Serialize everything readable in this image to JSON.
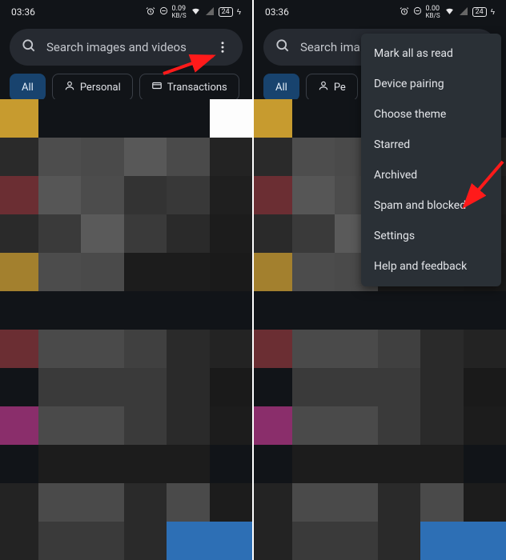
{
  "status": {
    "time": "03:36",
    "kbs_value": "0.09",
    "kbs_unit": "KB/S",
    "kbs_value2": "0.00",
    "battery": "24"
  },
  "search": {
    "placeholder_full": "Search images and videos",
    "placeholder_short": "Search ima"
  },
  "chips": {
    "all": "All",
    "personal": "Personal",
    "personal_short": "Pe",
    "transactions": "Transactions"
  },
  "menu": {
    "mark_all": "Mark all as read",
    "device_pairing": "Device pairing",
    "choose_theme": "Choose theme",
    "starred": "Starred",
    "archived": "Archived",
    "spam_blocked": "Spam and blocked",
    "settings": "Settings",
    "help": "Help and feedback"
  },
  "pixel_rows_left": [
    [
      "#c79b2f",
      "#111418",
      "#111418",
      "#111418",
      "#111418",
      "#fdfdfd"
    ],
    [
      "#2a2a2a",
      "#4d4d4d",
      "#4a4a4a",
      "#585858",
      "#4a4a4a",
      "#232323"
    ],
    [
      "#6b2e33",
      "#565656",
      "#4c4c4c",
      "#333333",
      "#383838",
      "#1f1f1f"
    ],
    [
      "#2a2a2a",
      "#3a3a3a",
      "#5a5a5a",
      "#3a3a3a",
      "#2a2a2a",
      "#1c1c1c"
    ],
    [
      "#a3802e",
      "#4c4c4c",
      "#4a4a4a",
      "#1c1c1c",
      "#1c1c1c",
      "#1a1a1a"
    ],
    [
      "#111418",
      "#111418",
      "#111418",
      "#111418",
      "#111418",
      "#111418"
    ],
    [
      "#6b2e33",
      "#4a4a4a",
      "#4a4a4a",
      "#404040",
      "#2a2a2a",
      "#232323"
    ],
    [
      "#111418",
      "#3a3a3a",
      "#3a3a3a",
      "#3a3a3a",
      "#2a2a2a",
      "#1a1a1a"
    ],
    [
      "#8a2e6b",
      "#4a4a4a",
      "#4a4a4a",
      "#3a3a3a",
      "#2a2a2a",
      "#1c1c1c"
    ],
    [
      "#111418",
      "#1c1c1c",
      "#1c1c1c",
      "#1c1c1c",
      "#1c1c1c",
      "#111418"
    ],
    [
      "#232323",
      "#4a4a4a",
      "#4a4a4a",
      "#2a2a2a",
      "#4a4a4a",
      "#1c1c1c"
    ],
    [
      "#232323",
      "#3a3a3a",
      "#3a3a3a",
      "#2a2a2a",
      "#2d6fb5",
      "#2d6fb5"
    ]
  ],
  "pixel_rows_right": [
    [
      "#c79b2f",
      "#111418",
      "#111418",
      "#111418",
      "#111418",
      "#111418"
    ],
    [
      "#2a2a2a",
      "#4d4d4d",
      "#4a4a4a",
      "#585858",
      "#4a4a4a",
      "#232323"
    ],
    [
      "#6b2e33",
      "#565656",
      "#4c4c4c",
      "#333333",
      "#383838",
      "#1f1f1f"
    ],
    [
      "#2a2a2a",
      "#3a3a3a",
      "#5a5a5a",
      "#3a3a3a",
      "#2a2a2a",
      "#1c1c1c"
    ],
    [
      "#a3802e",
      "#4c4c4c",
      "#4a4a4a",
      "#1c1c1c",
      "#1c1c1c",
      "#1a1a1a"
    ],
    [
      "#111418",
      "#111418",
      "#111418",
      "#111418",
      "#111418",
      "#111418"
    ],
    [
      "#6b2e33",
      "#4a4a4a",
      "#4a4a4a",
      "#404040",
      "#2a2a2a",
      "#232323"
    ],
    [
      "#111418",
      "#3a3a3a",
      "#3a3a3a",
      "#3a3a3a",
      "#2a2a2a",
      "#1a1a1a"
    ],
    [
      "#8a2e6b",
      "#4a4a4a",
      "#4a4a4a",
      "#3a3a3a",
      "#2a2a2a",
      "#1c1c1c"
    ],
    [
      "#111418",
      "#1c1c1c",
      "#1c1c1c",
      "#1c1c1c",
      "#1c1c1c",
      "#111418"
    ],
    [
      "#232323",
      "#4a4a4a",
      "#4a4a4a",
      "#2a2a2a",
      "#4a4a4a",
      "#1c1c1c"
    ],
    [
      "#232323",
      "#3a3a3a",
      "#3a3a3a",
      "#2a2a2a",
      "#2d6fb5",
      "#2d6fb5"
    ]
  ]
}
